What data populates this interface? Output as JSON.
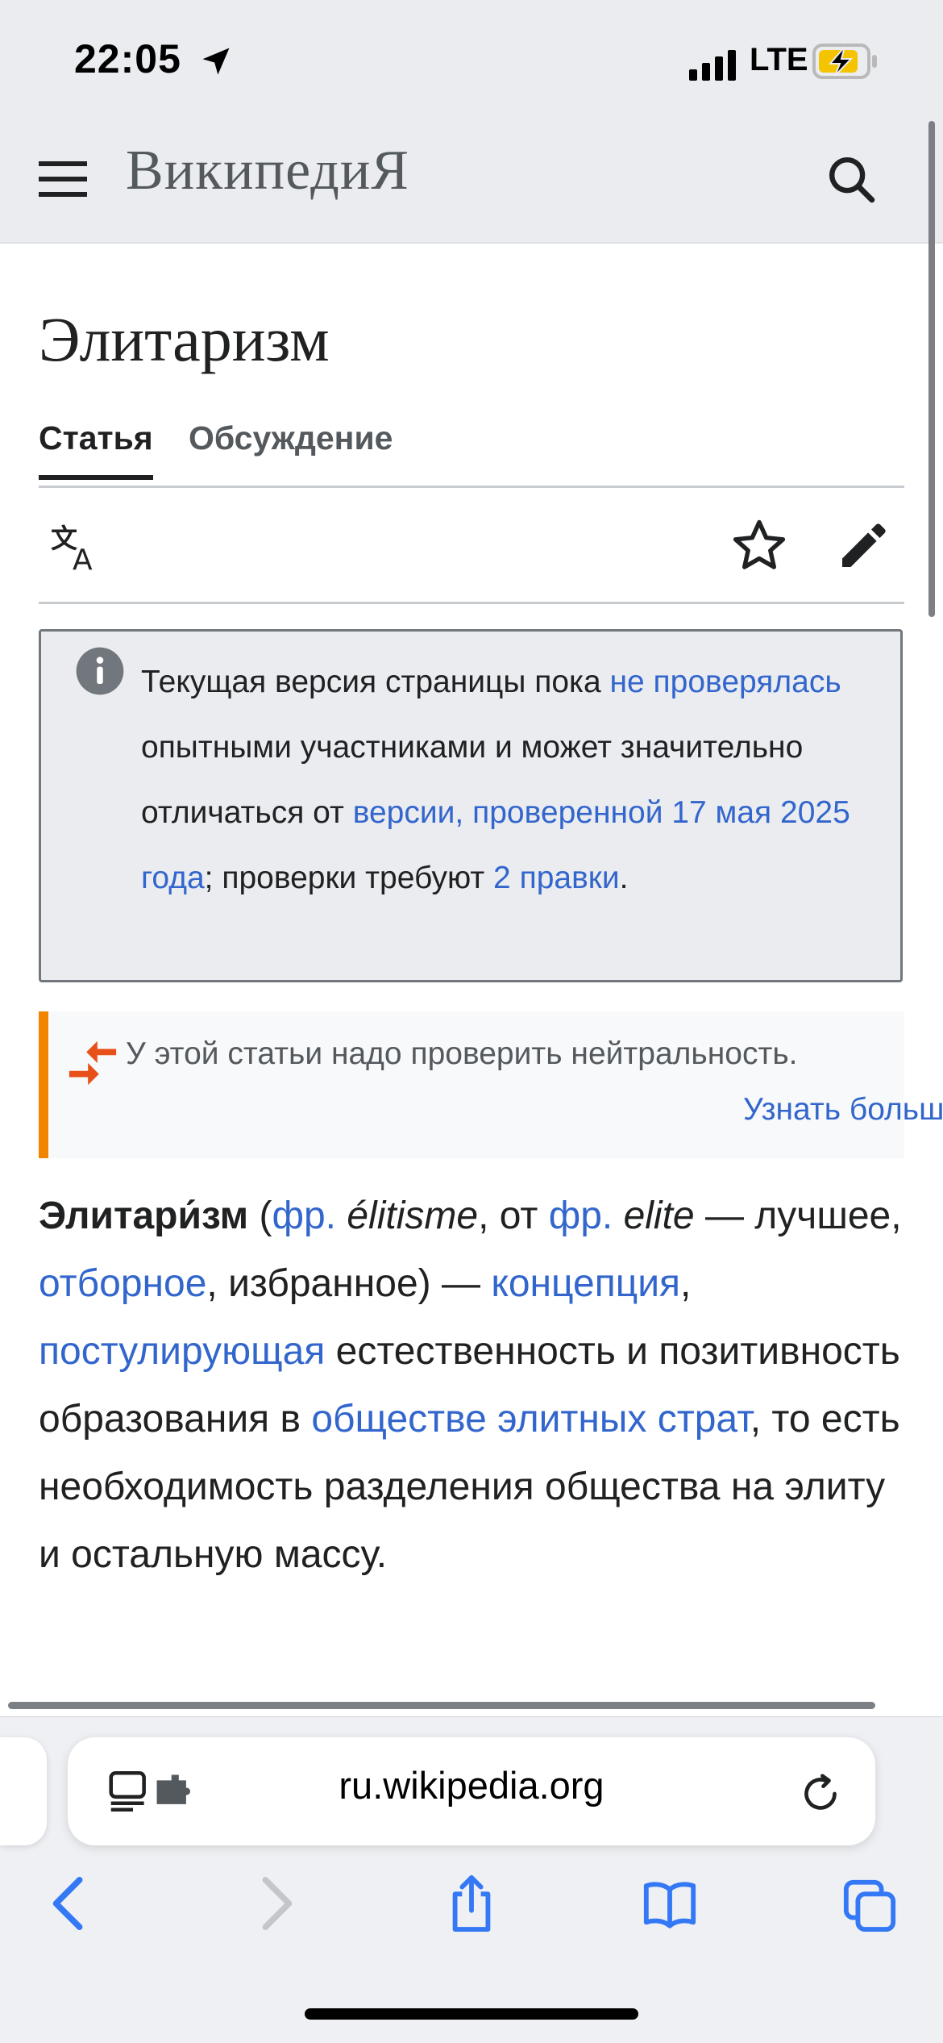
{
  "status_bar": {
    "time": "22:05",
    "network": "LTE"
  },
  "header": {
    "logo": "ВикипедиЯ"
  },
  "page": {
    "title": "Элитаризм"
  },
  "tabs": {
    "article": "Статья",
    "talk": "Обсуждение"
  },
  "notice": {
    "t1": "Текущая версия страницы пока ",
    "l1": "не проверялась",
    "t2": " опытными участниками и может значительно отличаться от ",
    "l2": "версии, проверенной 17 мая 2025 года",
    "t3": "; проверки требуют ",
    "l3": "2 правки",
    "t4": "."
  },
  "neutrality": {
    "text": "У этой статьи надо проверить нейтральность.",
    "more": "Узнать больше"
  },
  "article": {
    "term": "Элитари́зм",
    "p1": " (",
    "lang1": "фр.",
    "word1": " élitisme",
    "p2": ", от ",
    "lang2": "фр.",
    "word2": " elite",
    "p3": " — лучшее, ",
    "link_selected": "отборное",
    "p4": ", избранное) — ",
    "link_concept": "концепция",
    "p5": ", ",
    "link_postulating": "постулирующая",
    "p6": " естественность и позитивность образования в ",
    "link_society": "обществе элитных страт",
    "p7": ", то есть необходимость разделения общества на элиту и остальную массу."
  },
  "browser": {
    "url": "ru.wikipedia.org"
  },
  "icons": {
    "menu": "hamburger-menu-icon",
    "search": "search-icon",
    "language": "translate-icon",
    "watch": "star-icon",
    "edit": "pencil-icon",
    "info": "info-icon",
    "neutrality": "merge-arrows-icon",
    "reader": "reader-mode-icon",
    "reload": "reload-icon",
    "back": "chevron-left-icon",
    "forward": "chevron-right-icon",
    "share": "share-icon",
    "bookmarks": "book-icon",
    "tabs": "tabs-icon"
  },
  "colors": {
    "link": "#3366cc",
    "header_bg": "#eaecf0",
    "neutrality_accent": "#f28500",
    "neutrality_icon": "#e8501a",
    "safari_accent": "#3478f6"
  }
}
